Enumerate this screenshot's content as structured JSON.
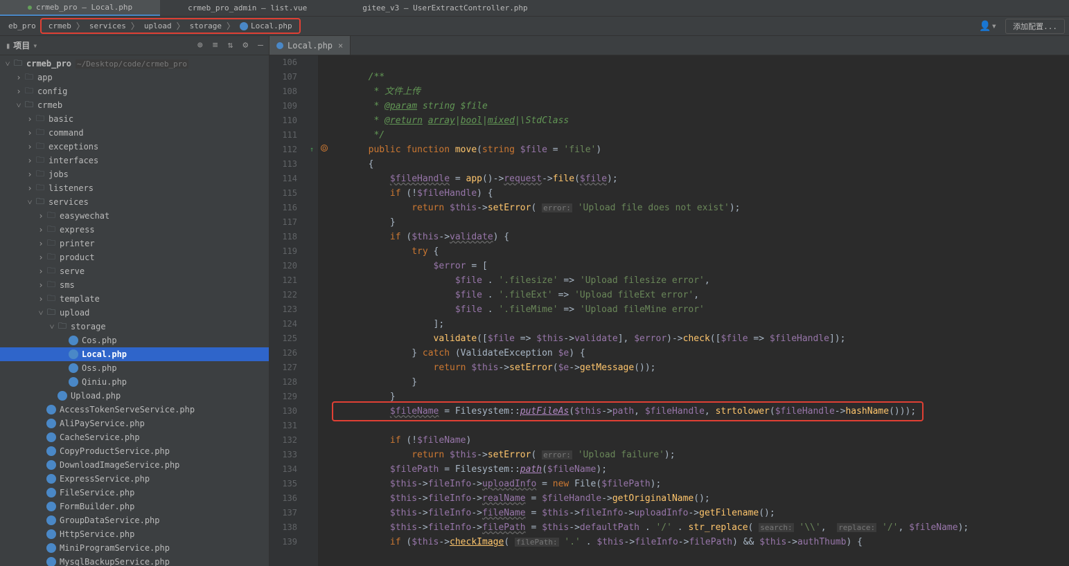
{
  "topTabs": [
    {
      "label": "crmeb_pro – Local.php",
      "active": true
    },
    {
      "label": "crmeb_pro_admin – list.vue",
      "active": false
    },
    {
      "label": "gitee_v3 – UserExtractController.php",
      "active": false
    }
  ],
  "breadcrumb": {
    "prefix": "eb_pro",
    "items": [
      "crmeb",
      "services",
      "upload",
      "storage",
      "Local.php"
    ],
    "addConfig": "添加配置..."
  },
  "projectPanel": {
    "title": "项目",
    "tools": [
      "⊕",
      "≡",
      "↕",
      "⚙",
      "—"
    ],
    "root": {
      "label": "crmeb_pro",
      "hint": "~/Desktop/code/crmeb_pro"
    },
    "tree": [
      {
        "indent": 1,
        "type": "folder",
        "expand": "closed",
        "label": "app"
      },
      {
        "indent": 1,
        "type": "folder",
        "expand": "closed",
        "label": "config"
      },
      {
        "indent": 1,
        "type": "folder",
        "expand": "open",
        "label": "crmeb"
      },
      {
        "indent": 2,
        "type": "folder",
        "expand": "closed",
        "label": "basic"
      },
      {
        "indent": 2,
        "type": "folder",
        "expand": "closed",
        "label": "command"
      },
      {
        "indent": 2,
        "type": "folder",
        "expand": "closed",
        "label": "exceptions"
      },
      {
        "indent": 2,
        "type": "folder",
        "expand": "closed",
        "label": "interfaces"
      },
      {
        "indent": 2,
        "type": "folder",
        "expand": "closed",
        "label": "jobs"
      },
      {
        "indent": 2,
        "type": "folder",
        "expand": "closed",
        "label": "listeners"
      },
      {
        "indent": 2,
        "type": "folder",
        "expand": "open",
        "label": "services"
      },
      {
        "indent": 3,
        "type": "folder",
        "expand": "closed",
        "label": "easywechat"
      },
      {
        "indent": 3,
        "type": "folder",
        "expand": "closed",
        "label": "express"
      },
      {
        "indent": 3,
        "type": "folder",
        "expand": "closed",
        "label": "printer"
      },
      {
        "indent": 3,
        "type": "folder",
        "expand": "closed",
        "label": "product"
      },
      {
        "indent": 3,
        "type": "folder",
        "expand": "closed",
        "label": "serve"
      },
      {
        "indent": 3,
        "type": "folder",
        "expand": "closed",
        "label": "sms"
      },
      {
        "indent": 3,
        "type": "folder",
        "expand": "closed",
        "label": "template"
      },
      {
        "indent": 3,
        "type": "folder",
        "expand": "open",
        "label": "upload"
      },
      {
        "indent": 4,
        "type": "folder",
        "expand": "open",
        "label": "storage"
      },
      {
        "indent": 5,
        "type": "php",
        "label": "Cos.php"
      },
      {
        "indent": 5,
        "type": "php",
        "label": "Local.php",
        "selected": true
      },
      {
        "indent": 5,
        "type": "php",
        "label": "Oss.php"
      },
      {
        "indent": 5,
        "type": "php",
        "label": "Qiniu.php"
      },
      {
        "indent": 4,
        "type": "php",
        "label": "Upload.php"
      },
      {
        "indent": 3,
        "type": "php",
        "label": "AccessTokenServeService.php"
      },
      {
        "indent": 3,
        "type": "php",
        "label": "AliPayService.php"
      },
      {
        "indent": 3,
        "type": "php",
        "label": "CacheService.php"
      },
      {
        "indent": 3,
        "type": "php",
        "label": "CopyProductService.php"
      },
      {
        "indent": 3,
        "type": "php",
        "label": "DownloadImageService.php"
      },
      {
        "indent": 3,
        "type": "php",
        "label": "ExpressService.php"
      },
      {
        "indent": 3,
        "type": "php",
        "label": "FileService.php"
      },
      {
        "indent": 3,
        "type": "php",
        "label": "FormBuilder.php"
      },
      {
        "indent": 3,
        "type": "php",
        "label": "GroupDataService.php"
      },
      {
        "indent": 3,
        "type": "php",
        "label": "HttpService.php"
      },
      {
        "indent": 3,
        "type": "php",
        "label": "MiniProgramService.php"
      },
      {
        "indent": 3,
        "type": "php",
        "label": "MysqlBackupService.php"
      }
    ]
  },
  "editorTab": {
    "label": "Local.php"
  },
  "code": {
    "startLine": 106,
    "lines": [
      {
        "html": ""
      },
      {
        "html": "        <span class='doc'>/**</span>"
      },
      {
        "html": "        <span class='doc'> * 文件上传</span>"
      },
      {
        "html": "        <span class='doc'> * <span class='doctag'>@param</span> string $file</span>"
      },
      {
        "html": "        <span class='doc'> * <span class='doctag'>@return</span> <span style='text-decoration:underline'>array</span>|<span style='text-decoration:underline'>bool</span>|<span style='text-decoration:underline'>mixed</span>|\\StdClass</span>"
      },
      {
        "html": "        <span class='doc'> */</span>"
      },
      {
        "html": "        <span class='kw'>public function</span> <span class='fn'>move</span>(<span class='kw'>string</span> <span class='var'>$file</span> = <span class='str'>'file'</span>)",
        "anno": "o↑"
      },
      {
        "html": "        {"
      },
      {
        "html": "            <span class='var wavy'>$fileHandle</span> = <span class='fn'>app</span>()-&gt;<span class='var wavy'>request</span>-&gt;<span class='fn'>file</span>(<span class='var wavy'>$file</span>);"
      },
      {
        "html": "            <span class='kw'>if</span> (!<span class='var'>$fileHandle</span>) {"
      },
      {
        "html": "                <span class='kw'>return</span> <span class='var'>$this</span>-&gt;<span class='fn'>setError</span>( <span class='hint'>error:</span> <span class='str'>'Upload file does not exist'</span>);"
      },
      {
        "html": "            }"
      },
      {
        "html": "            <span class='kw'>if</span> (<span class='var'>$this</span>-&gt;<span class='var wavy'>validate</span>) {"
      },
      {
        "html": "                <span class='kw'>try</span> {"
      },
      {
        "html": "                    <span class='var'>$error</span> = ["
      },
      {
        "html": "                        <span class='var'>$file</span> . <span class='str'>'.filesize'</span> =&gt; <span class='str'>'Upload filesize error'</span>,"
      },
      {
        "html": "                        <span class='var'>$file</span> . <span class='str'>'.fileExt'</span> =&gt; <span class='str'>'Upload fileExt error'</span>,"
      },
      {
        "html": "                        <span class='var'>$file</span> . <span class='str'>'.fileMime'</span> =&gt; <span class='str'>'Upload fileMine error'</span>"
      },
      {
        "html": "                    ];"
      },
      {
        "html": "                    <span class='fn'>validate</span>([<span class='var'>$file</span> =&gt; <span class='var'>$this</span>-&gt;<span class='var'>validate</span>], <span class='var'>$error</span>)-&gt;<span class='fn'>check</span>([<span class='var'>$file</span> =&gt; <span class='var'>$fileHandle</span>]);"
      },
      {
        "html": "                } <span class='kw'>catch</span> (ValidateException <span class='var'>$e</span>) {"
      },
      {
        "html": "                    <span class='kw'>return</span> <span class='var'>$this</span>-&gt;<span class='fn'>setError</span>(<span class='var'>$e</span>-&gt;<span class='fn'>getMessage</span>());"
      },
      {
        "html": "                }"
      },
      {
        "html": "            }"
      },
      {
        "html": "            <span class='var wavy'>$fileName</span> = Filesystem::<span class='fni'>putFileAs</span>(<span class='var'>$this</span>-&gt;<span class='var'>path</span>, <span class='var'>$fileHandle</span>, <span class='fn'>strtolower</span>(<span class='var'>$fileHandle</span>-&gt;<span class='fn'>hashName</span>()));",
        "hl": true
      },
      {
        "html": ""
      },
      {
        "html": "            <span class='kw'>if</span> (!<span class='var'>$fileName</span>)"
      },
      {
        "html": "                <span class='kw'>return</span> <span class='var'>$this</span>-&gt;<span class='fn'>setError</span>( <span class='hint'>error:</span> <span class='str'>'Upload failure'</span>);"
      },
      {
        "html": "            <span class='var'>$filePath</span> = Filesystem::<span class='fni'>path</span>(<span class='var'>$fileName</span>);"
      },
      {
        "html": "            <span class='var'>$this</span>-&gt;<span class='var'>fileInfo</span>-&gt;<span class='var wavy'>uploadInfo</span> = <span class='kw'>new</span> File(<span class='var'>$filePath</span>);"
      },
      {
        "html": "            <span class='var'>$this</span>-&gt;<span class='var'>fileInfo</span>-&gt;<span class='var wavy'>realName</span> = <span class='var'>$fileHandle</span>-&gt;<span class='fn'>getOriginalName</span>();"
      },
      {
        "html": "            <span class='var'>$this</span>-&gt;<span class='var'>fileInfo</span>-&gt;<span class='var wavy'>fileName</span> = <span class='var'>$this</span>-&gt;<span class='var'>fileInfo</span>-&gt;<span class='var'>uploadInfo</span>-&gt;<span class='fn'>getFilename</span>();"
      },
      {
        "html": "            <span class='var'>$this</span>-&gt;<span class='var'>fileInfo</span>-&gt;<span class='var wavy'>filePath</span> = <span class='var'>$this</span>-&gt;<span class='var'>defaultPath</span> . <span class='str'>'/'</span> . <span class='fn'>str_replace</span>( <span class='hint'>search:</span> <span class='str'>'\\\\'</span>,  <span class='hint'>replace:</span> <span class='str'>'/'</span>, <span class='var'>$fileName</span>);"
      },
      {
        "html": "            <span class='kw'>if</span> (<span class='var'>$this</span>-&gt;<span class='fnu'>checkImage</span>( <span class='hint'>filePath:</span> <span class='str'>'.'</span> . <span class='var'>$this</span>-&gt;<span class='var'>fileInfo</span>-&gt;<span class='var'>filePath</span>) &amp;&amp; <span class='var'>$this</span>-&gt;<span class='var'>authThumb</span>) {"
      }
    ]
  }
}
